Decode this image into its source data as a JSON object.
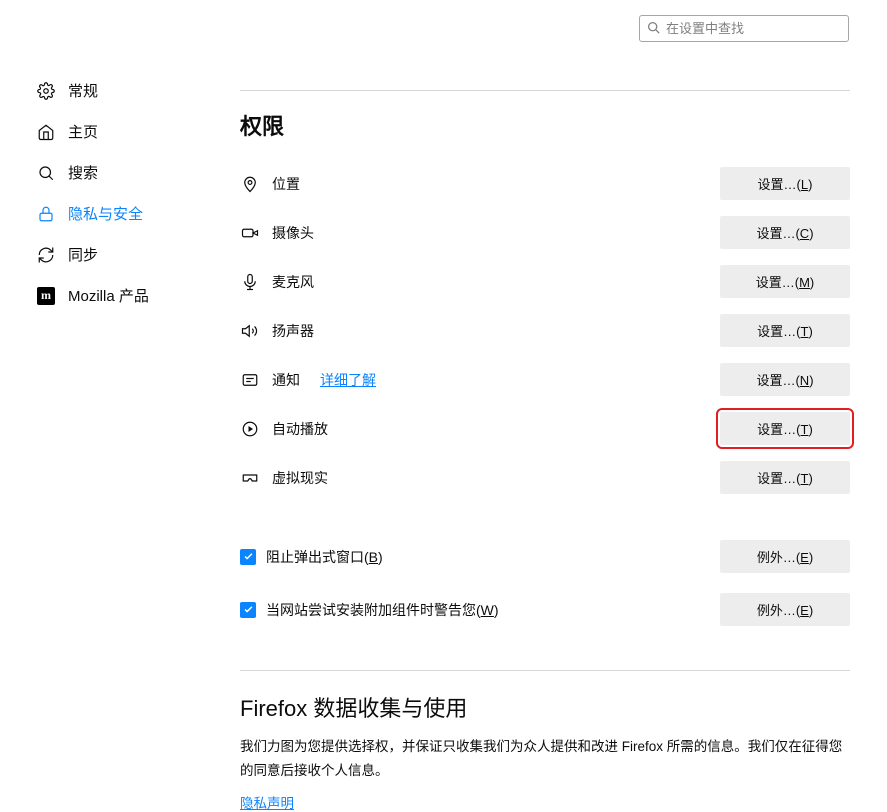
{
  "search": {
    "placeholder": "在设置中查找"
  },
  "sidebar": {
    "items": [
      {
        "label": "常规"
      },
      {
        "label": "主页"
      },
      {
        "label": "搜索"
      },
      {
        "label": "隐私与安全"
      },
      {
        "label": "同步"
      },
      {
        "label": "Mozilla 产品"
      }
    ]
  },
  "permissions": {
    "title": "权限",
    "rows": [
      {
        "label": "位置",
        "btn_pre": "设置…(",
        "btn_key": "L",
        "btn_post": ")"
      },
      {
        "label": "摄像头",
        "btn_pre": "设置…(",
        "btn_key": "C",
        "btn_post": ")"
      },
      {
        "label": "麦克风",
        "btn_pre": "设置…(",
        "btn_key": "M",
        "btn_post": ")"
      },
      {
        "label": "扬声器",
        "btn_pre": "设置…(",
        "btn_key": "T",
        "btn_post": ")"
      },
      {
        "label": "通知",
        "more": "详细了解",
        "btn_pre": "设置…(",
        "btn_key": "N",
        "btn_post": ")"
      },
      {
        "label": "自动播放",
        "btn_pre": "设置…(",
        "btn_key": "T",
        "btn_post": ")"
      },
      {
        "label": "虚拟现实",
        "btn_pre": "设置…(",
        "btn_key": "T",
        "btn_post": ")"
      }
    ],
    "checkboxes": [
      {
        "label_pre": "阻止弹出式窗口(",
        "label_key": "B",
        "label_post": ")",
        "btn_pre": "例外…(",
        "btn_key": "E",
        "btn_post": ")"
      },
      {
        "label_pre": "当网站尝试安装附加组件时警告您(",
        "label_key": "W",
        "label_post": ")",
        "btn_pre": "例外…(",
        "btn_key": "E",
        "btn_post": ")"
      }
    ]
  },
  "data_section": {
    "title": "Firefox 数据收集与使用",
    "desc": "我们力图为您提供选择权，并保证只收集我们为众人提供和改进 Firefox 所需的信息。我们仅在征得您的同意后接收个人信息。",
    "privacy_link": "隐私声明"
  }
}
